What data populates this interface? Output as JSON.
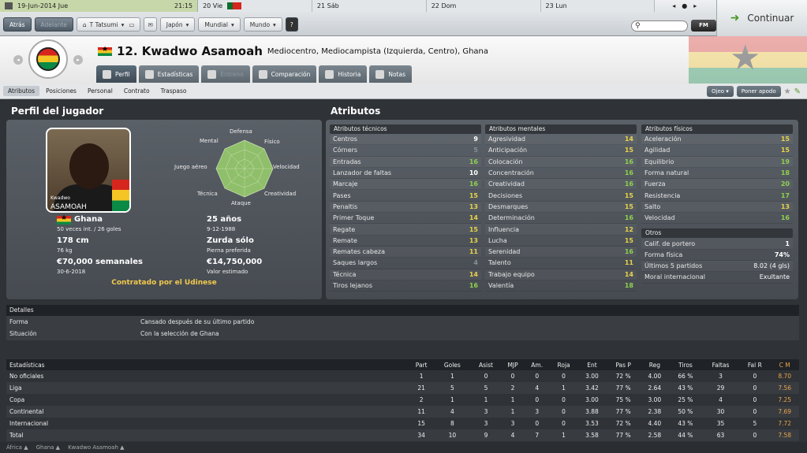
{
  "topbar": {
    "date": "19-Jun-2014 Jue",
    "time": "21:15",
    "days": [
      {
        "label": "20 Vie"
      },
      {
        "label": "21 Sáb"
      },
      {
        "label": "22 Dom"
      },
      {
        "label": "23 Lun"
      }
    ],
    "back_label": "Atrás",
    "forward_label": "Adelante",
    "manager": "T Tatsumi",
    "menu1": "Japón",
    "menu2": "Mundial",
    "menu3": "Mundo",
    "help": "?",
    "fm_label": "FM",
    "continue_label": "Continuar"
  },
  "header": {
    "number_name": "12. Kwadwo Asamoah",
    "position": "Mediocentro, Mediocampista (Izquierda, Centro), Ghana",
    "tabs": [
      "Perfil",
      "Estadísticas",
      "Entreno",
      "Comparación",
      "Historia",
      "Notas"
    ]
  },
  "subnav": {
    "items": [
      "Atributos",
      "Posiciones",
      "Personal",
      "Contrato",
      "Traspaso"
    ],
    "eye": "Ojeo",
    "nickname": "Poner apodo"
  },
  "profile": {
    "title": "Perfil del jugador",
    "photo_first": "Kwadwo",
    "photo_last": "ASAMOAH",
    "radar": [
      "Defensa",
      "Físico",
      "Velocidad",
      "Creatividad",
      "Ataque",
      "Técnica",
      "Juego aéreo",
      "Mental"
    ],
    "nation": "Ghana",
    "caps": "50 veces int. / 26 goles",
    "age": "25 años",
    "dob": "9-12-1988",
    "height": "178 cm",
    "weight": "76 kg",
    "foot": "Zurda sólo",
    "foot_label": "Pierna preferida",
    "wage": "€70,000 semanales",
    "contract_end": "30-6-2018",
    "value": "€14,750,000",
    "value_label": "Valor estimado",
    "contract": "Contratado por el Udinese"
  },
  "attributes": {
    "title": "Atributos",
    "technical_title": "Atributos técnicos",
    "technical": [
      [
        "Centros",
        "9"
      ],
      [
        "Córners",
        "5"
      ],
      [
        "Entradas",
        "16"
      ],
      [
        "Lanzador de faltas",
        "10"
      ],
      [
        "Marcaje",
        "16"
      ],
      [
        "Pases",
        "15"
      ],
      [
        "Penaltis",
        "13"
      ],
      [
        "Primer Toque",
        "14"
      ],
      [
        "Regate",
        "15"
      ],
      [
        "Remate",
        "13"
      ],
      [
        "Remates cabeza",
        "11"
      ],
      [
        "Saques largos",
        "4"
      ],
      [
        "Técnica",
        "14"
      ],
      [
        "Tiros lejanos",
        "16"
      ]
    ],
    "mental_title": "Atributos mentales",
    "mental": [
      [
        "Agresividad",
        "14"
      ],
      [
        "Anticipación",
        "15"
      ],
      [
        "Colocación",
        "16"
      ],
      [
        "Concentración",
        "16"
      ],
      [
        "Creatividad",
        "16"
      ],
      [
        "Decisiones",
        "15"
      ],
      [
        "Desmarques",
        "15"
      ],
      [
        "Determinación",
        "16"
      ],
      [
        "Influencia",
        "12"
      ],
      [
        "Lucha",
        "15"
      ],
      [
        "Serenidad",
        "16"
      ],
      [
        "Talento",
        "11"
      ],
      [
        "Trabajo equipo",
        "14"
      ],
      [
        "Valentía",
        "18"
      ]
    ],
    "physical_title": "Atributos físicos",
    "physical": [
      [
        "Aceleración",
        "15"
      ],
      [
        "Agilidad",
        "15"
      ],
      [
        "Equilibrio",
        "19"
      ],
      [
        "Forma natural",
        "18"
      ],
      [
        "Fuerza",
        "20"
      ],
      [
        "Resistencia",
        "17"
      ],
      [
        "Salto",
        "13"
      ],
      [
        "Velocidad",
        "16"
      ]
    ],
    "other_title": "Otros",
    "other": [
      [
        "Calif. de portero",
        "1"
      ],
      [
        "Forma física",
        "74%"
      ],
      [
        "Últimos 5 partidos",
        "8.02 (4 gls)"
      ],
      [
        "Moral internacional",
        "Exultante"
      ]
    ]
  },
  "details": {
    "title": "Detalles",
    "rows": [
      [
        "Forma",
        "Cansado después de su último partido"
      ],
      [
        "Situación",
        "Con la selección de Ghana"
      ]
    ]
  },
  "stats": {
    "headers": [
      "Estadísticas",
      "Part",
      "Goles",
      "Asist",
      "MJP",
      "Am.",
      "Roja",
      "Ent",
      "Pas P",
      "Reg",
      "Tiros",
      "Faltas",
      "Fal R",
      "C M"
    ],
    "rows": [
      [
        "No oficiales",
        "1",
        "1",
        "0",
        "0",
        "0",
        "0",
        "3.00",
        "72 %",
        "4.00",
        "66 %",
        "3",
        "0",
        "8.70"
      ],
      [
        "Liga",
        "21",
        "5",
        "5",
        "2",
        "4",
        "1",
        "3.42",
        "77 %",
        "2.64",
        "43 %",
        "29",
        "0",
        "7.56"
      ],
      [
        "Copa",
        "2",
        "1",
        "1",
        "1",
        "0",
        "0",
        "3.00",
        "75 %",
        "3.00",
        "25 %",
        "4",
        "0",
        "7.25"
      ],
      [
        "Continental",
        "11",
        "4",
        "3",
        "1",
        "3",
        "0",
        "3.88",
        "77 %",
        "2.38",
        "50 %",
        "30",
        "0",
        "7.69"
      ],
      [
        "Internacional",
        "15",
        "8",
        "3",
        "3",
        "0",
        "0",
        "3.53",
        "72 %",
        "4.40",
        "43 %",
        "35",
        "5",
        "7.72"
      ],
      [
        "Total",
        "34",
        "10",
        "9",
        "4",
        "7",
        "1",
        "3.58",
        "77 %",
        "2.58",
        "44 %",
        "63",
        "0",
        "7.58"
      ]
    ]
  },
  "footer": [
    "África ▲",
    "Ghana ▲",
    "Kwadwo Asamoah ▲"
  ]
}
